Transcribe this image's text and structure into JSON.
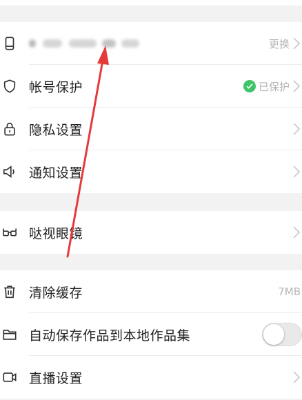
{
  "groups": {
    "account": {
      "phone_row": {
        "value_label": "更换",
        "icon": "phone-icon"
      },
      "protect_row": {
        "label": "帐号保护",
        "value_label": "已保护",
        "icon": "shield-icon"
      },
      "privacy_row": {
        "label": "隐私设置",
        "icon": "lock-icon"
      },
      "notify_row": {
        "label": "通知设置",
        "icon": "speaker-icon"
      }
    },
    "glasses": {
      "glasses_row": {
        "label": "哒视眼镜",
        "icon": "glasses-icon"
      }
    },
    "storage": {
      "cache_row": {
        "label": "清除缓存",
        "value_label": "7MB",
        "icon": "trash-icon"
      },
      "autosave_row": {
        "label": "自动保存作品到本地作品集",
        "icon": "folder-icon",
        "toggle_on": false
      },
      "live_row": {
        "label": "直播设置",
        "icon": "video-icon"
      }
    }
  },
  "colors": {
    "accent_green": "#3fc469",
    "annotation_red": "#e53a3a"
  }
}
